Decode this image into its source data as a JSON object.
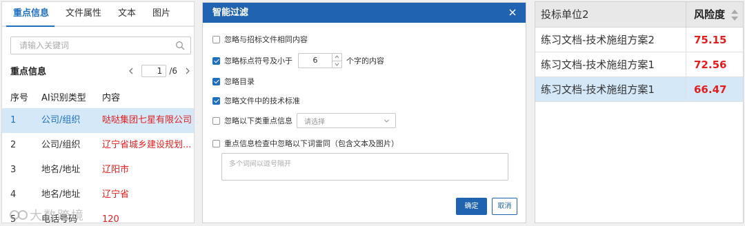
{
  "left_panel": {
    "tabs": [
      {
        "label": "重点信息",
        "active": true
      },
      {
        "label": "文件属性",
        "active": false
      },
      {
        "label": "文本",
        "active": false
      },
      {
        "label": "图片",
        "active": false
      }
    ],
    "search": {
      "placeholder": "请输入关键词",
      "value": ""
    },
    "section_title": "重点信息",
    "pager": {
      "current": "1",
      "total": "/6"
    },
    "table": {
      "headers": [
        "序号",
        "AI识别类型",
        "内容"
      ],
      "rows": [
        {
          "num": "1",
          "type": "公司/组织",
          "content": "哒哒集团七星有限公司",
          "selected": true
        },
        {
          "num": "2",
          "type": "公司/组织",
          "content": "辽宁省城乡建设规划...",
          "selected": false
        },
        {
          "num": "3",
          "type": "地名/地址",
          "content": "辽阳市",
          "selected": false
        },
        {
          "num": "4",
          "type": "地名/地址",
          "content": "辽宁省",
          "selected": false
        },
        {
          "num": "5",
          "type": "电话号码",
          "content": "120",
          "selected": false
        }
      ]
    },
    "watermark": "大数跨境"
  },
  "dialog": {
    "title": "智能过滤",
    "options": {
      "opt1": {
        "label": "忽略与招标文件相同内容",
        "checked": false
      },
      "opt2": {
        "label_before": "忽略标点符号及小于",
        "stepper_value": "6",
        "label_after": "个字的内容",
        "checked": true
      },
      "opt3": {
        "label": "忽略目录",
        "checked": true
      },
      "opt4": {
        "label": "忽略文件中的技术标准",
        "checked": true
      },
      "opt5": {
        "label": "忽略以下类重点信息",
        "select_placeholder": "请选择",
        "checked": false
      },
      "opt6": {
        "label": "重点信息检查中忽略以下词雷同（包含文本及图片）",
        "checked": false
      }
    },
    "textarea_placeholder": "多个词间以逗号隔开",
    "ok_label": "确定",
    "cancel_label": "取消"
  },
  "right_panel": {
    "headers": {
      "unit": "投标单位2",
      "risk": "风险度"
    },
    "rows": [
      {
        "unit": "练习文档-技术施组方案2",
        "score": "75.15",
        "selected": false
      },
      {
        "unit": "练习文档-技术施组方案1",
        "score": "72.56",
        "selected": false
      },
      {
        "unit": "练习文档-技术施组方案1",
        "score": "66.47",
        "selected": true
      }
    ]
  },
  "colors": {
    "accent": "#1e6fbf",
    "header_blue": "#2063b0",
    "highlight": "#e02020",
    "selected_row": "#d4e8f8"
  }
}
